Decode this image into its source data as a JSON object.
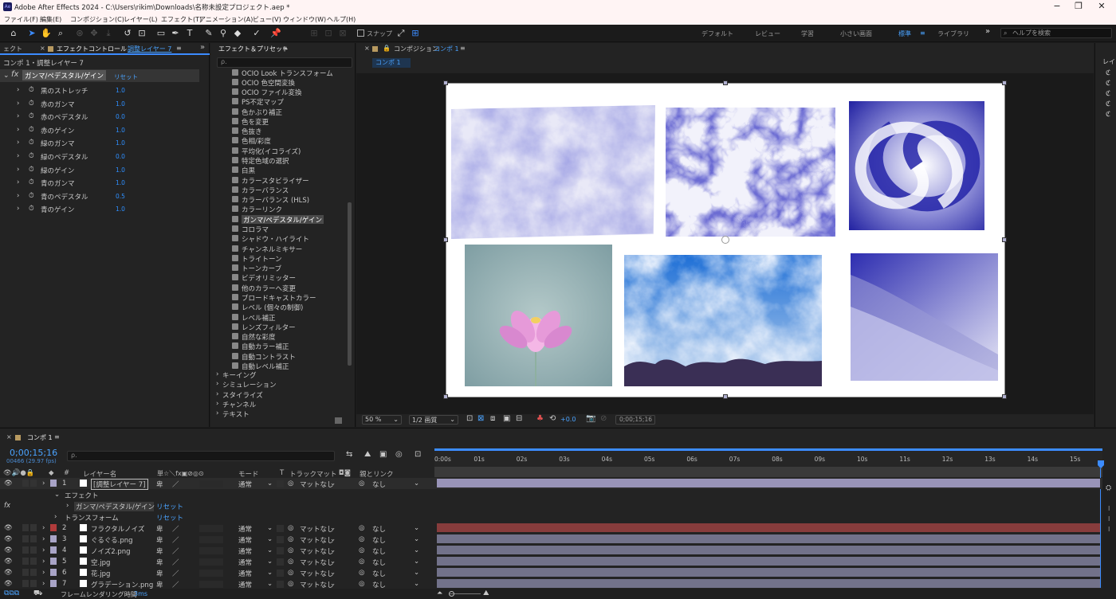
{
  "titlebar": {
    "app_badge": "Ae",
    "title": "Adobe After Effects 2024 - C:\\Users\\rikim\\Downloads\\名称未設定プロジェクト.aep *",
    "min": "−",
    "max": "❐",
    "close": "✕"
  },
  "menu": [
    "ファイル(F)",
    "編集(E)",
    "コンポジション(C)",
    "レイヤー(L)",
    "エフェクト(T)",
    "アニメーション(A)",
    "ビュー(V)",
    "ウィンドウ(W)",
    "ヘルプ(H)"
  ],
  "toolbar": {
    "snap_label": "スナップ",
    "workspaces": [
      "デフォルト",
      "レビュー",
      "学習",
      "小さい画面",
      "標準",
      "ライブラリ"
    ],
    "active_workspace": "標準",
    "more": "»",
    "help_placeholder": "ヘルプを検索"
  },
  "effect_controls": {
    "left_tab": "ェクト",
    "tab_label": "エフェクトコントロール",
    "tab_layer": "調整レイヤー 7",
    "menu_icon": "≡",
    "collapse": "»",
    "breadcrumb": "コンポ 1・調整レイヤー 7",
    "fx_label": "fx",
    "effect_name": "ガンマ/ペデスタル/ゲイン",
    "reset": "リセット",
    "params": [
      {
        "name": "黒のストレッチ",
        "value": "1.0"
      },
      {
        "name": "赤のガンマ",
        "value": "1.0"
      },
      {
        "name": "赤のペデスタル",
        "value": "0.0"
      },
      {
        "name": "赤のゲイン",
        "value": "1.0"
      },
      {
        "name": "緑のガンマ",
        "value": "1.0"
      },
      {
        "name": "緑のペデスタル",
        "value": "0.0"
      },
      {
        "name": "緑のゲイン",
        "value": "1.0"
      },
      {
        "name": "青のガンマ",
        "value": "1.0"
      },
      {
        "name": "青のペデスタル",
        "value": "0.5"
      },
      {
        "name": "青のゲイン",
        "value": "1.0"
      }
    ]
  },
  "effects_presets": {
    "tab": "エフェクト＆プリセット",
    "menu_icon": "≡",
    "search_placeholder": "ρ.",
    "items": [
      "OCIO Look トランスフォーム",
      "OCIO 色空間変換",
      "OCIO ファイル変換",
      "PS不定マップ",
      "色かぶり補正",
      "色を変更",
      "色抜き",
      "色相/彩度",
      "平均化(イコライズ)",
      "特定色域の選択",
      "白黒",
      "カラースタビライザー",
      "カラーバランス",
      "カラーバランス (HLS)",
      "カラーリンク",
      "ガンマ/ペデスタル/ゲイン",
      "コロラマ",
      "シャドウ・ハイライト",
      "チャンネルミキサー",
      "トライトーン",
      "トーンカーブ",
      "ビデオリミッター",
      "他のカラーへ変更",
      "ブロードキャストカラー",
      "レベル (個々の制御)",
      "レベル補正",
      "レンズフィルター",
      "自然な彩度",
      "自動カラー補正",
      "自動コントラスト",
      "自動レベル補正"
    ],
    "selected": "ガンマ/ペデスタル/ゲイン",
    "categories": [
      "キーイング",
      "シミュレーション",
      "スタイライズ",
      "チャンネル",
      "テキスト"
    ]
  },
  "composition": {
    "tab_prefix": "コンポジション",
    "tab_name": "コンポ 1",
    "menu_icon": "≡",
    "subtab": "コンポ 1",
    "zoom": "50 %",
    "resolution": "1/2 画質",
    "exposure": "+0.0",
    "timecode": "0;00;15;16",
    "side_label": "レイ"
  },
  "timeline": {
    "tab": "コンポ 1",
    "menu_icon": "≡",
    "timecode": "0;00;15;16",
    "frames": "00466 (29.97 fps)",
    "search_placeholder": "ρ.",
    "headers": {
      "num": "#",
      "layer_name": "レイヤー名",
      "switches": "単☆＼fx▣⊘◎⊙",
      "mode": "モード",
      "t": "T",
      "track_matte": "トラックマット",
      "parent": "親とリンク"
    },
    "ruler": [
      "0:00s",
      "01s",
      "02s",
      "03s",
      "04s",
      "05s",
      "06s",
      "07s",
      "08s",
      "09s",
      "10s",
      "11s",
      "12s",
      "13s",
      "14s",
      "15s"
    ],
    "layers": [
      {
        "num": "1",
        "name": "[調整レイヤー 7]",
        "mode": "通常",
        "matte": "マットなし",
        "parent": "なし",
        "color": "#a9a4c7",
        "bar_color": "#9994b8"
      },
      {
        "num": "2",
        "name": "フラクタルノイズ",
        "mode": "通常",
        "matte": "マットなし",
        "parent": "なし",
        "color": "#b03b3b",
        "bar_color": "#873c3c"
      },
      {
        "num": "3",
        "name": "ぐるぐる.png",
        "mode": "通常",
        "matte": "マットなし",
        "parent": "なし",
        "color": "#a9a4c7",
        "bar_color": "#72728a"
      },
      {
        "num": "4",
        "name": "ノイズ2.png",
        "mode": "通常",
        "matte": "マットなし",
        "parent": "なし",
        "color": "#a9a4c7",
        "bar_color": "#72728a"
      },
      {
        "num": "5",
        "name": "空.jpg",
        "mode": "通常",
        "matte": "マットなし",
        "parent": "なし",
        "color": "#a9a4c7",
        "bar_color": "#72728a"
      },
      {
        "num": "6",
        "name": "花.jpg",
        "mode": "通常",
        "matte": "マットなし",
        "parent": "なし",
        "color": "#a9a4c7",
        "bar_color": "#72728a"
      },
      {
        "num": "7",
        "name": "グラデーション.png",
        "mode": "通常",
        "matte": "マットなし",
        "parent": "なし",
        "color": "#a9a4c7",
        "bar_color": "#72728a"
      }
    ],
    "effect_group": "エフェクト",
    "effect_name": "ガンマ/ペデスタル/ゲイン",
    "effect_reset": "リセット",
    "transform": "トランスフォーム",
    "transform_reset": "リセット",
    "fx_label": "fx",
    "render_time_label": "フレームレンダリング時間",
    "render_time": "3ms"
  }
}
